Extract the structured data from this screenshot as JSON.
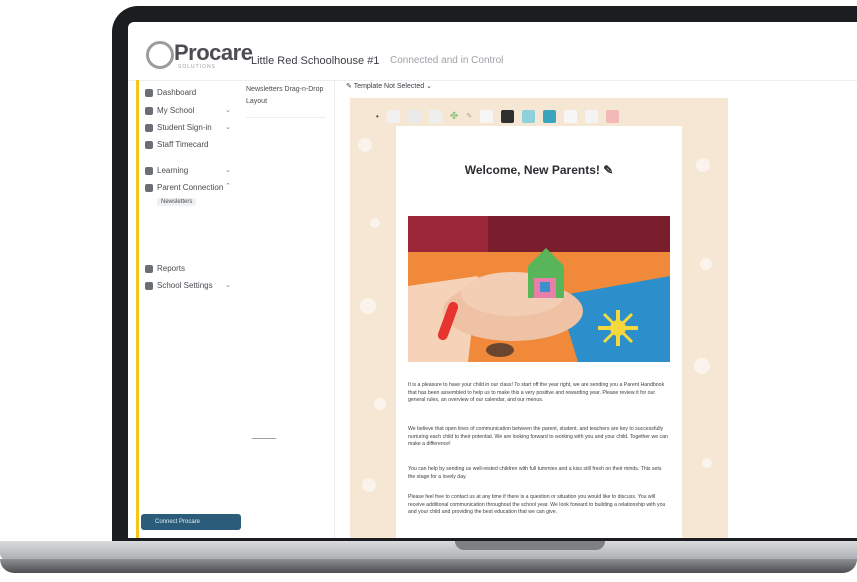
{
  "app": {
    "brand": "Procare",
    "brand_sub": "SOLUTIONS",
    "school": "Little Red Schoolhouse #1",
    "connection": "Connected and in Control"
  },
  "sidebar": {
    "items": [
      {
        "label": "Dashboard",
        "icon": "dashboard-icon"
      },
      {
        "label": "My School",
        "icon": "school-icon"
      },
      {
        "label": "Student Sign-in",
        "icon": "calendar-icon"
      },
      {
        "label": "Staff Timecard",
        "icon": "clock-icon"
      },
      {
        "label": "Learning",
        "icon": "learning-icon"
      },
      {
        "label": "Parent Connection",
        "icon": "people-icon"
      },
      {
        "label": "Reports",
        "icon": "report-icon"
      },
      {
        "label": "School Settings",
        "icon": "settings-icon"
      }
    ],
    "subitems": [
      "Newsletters"
    ],
    "connect_button": "Connect Procare"
  },
  "panel": {
    "tabs": "Newsletters Drag-n-Drop",
    "layout": "Layout"
  },
  "editor": {
    "template_selector": "Template Not Selected",
    "swatch_colors": [
      "#f1f1f1",
      "#eaeaea",
      "#eeeeee",
      "#ededed",
      "#8fc37b",
      "#2f2f31",
      "#8ed1dc",
      "#3aa4bf",
      "#f6f6f6",
      "#f7f7f7",
      "#f3b9b9"
    ]
  },
  "document": {
    "title": "Welcome, New Parents!",
    "paragraphs": [
      "It is a pleasure to have your child in our class! To start off the year right, we are sending you a Parent Handbook that has been assembled to help us to make this a very positive and rewarding year. Please review it for our general rules, an overview of our calendar, and our menus.",
      "We believe that open lines of communication between the parent, student, and teachers are key to successfully nurturing each child to their potential. We are looking forward to working with you and your child. Together we can make a difference!",
      "You can help by sending us well-rested children with full tummies and a kiss still fresh on their minds. This sets the stage for a lovely day.",
      "Please feel free to contact us at any time if there is a question or situation you would like to discuss. You will receive additional communication throughout the school year. We look forward to building a relationship with you and your child and providing the best education that we can give."
    ]
  }
}
